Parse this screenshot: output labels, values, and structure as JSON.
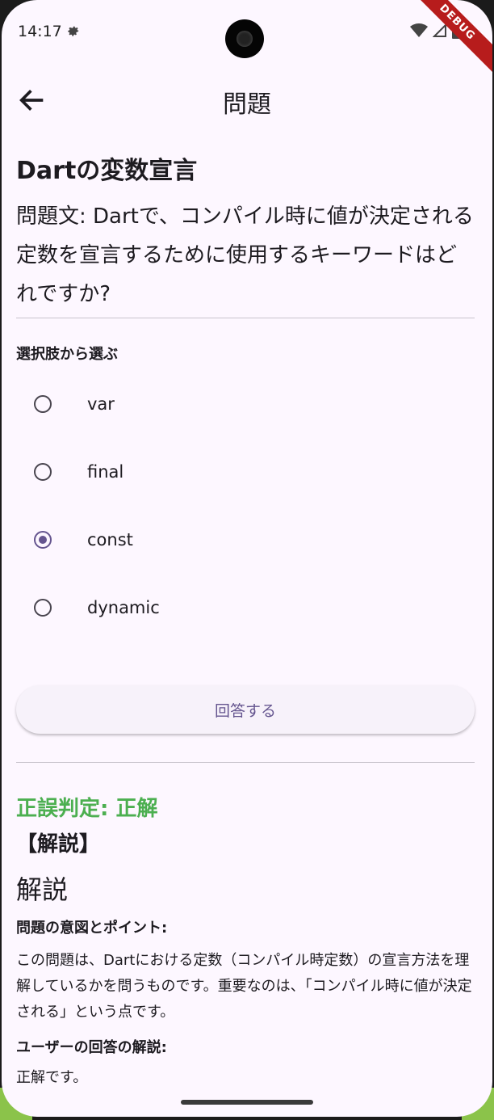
{
  "status_bar": {
    "time": "14:17",
    "debug_label": "DEBUG"
  },
  "app_bar": {
    "title": "問題"
  },
  "question": {
    "title": "Dartの変数宣言",
    "text": "問題文: Dartで、コンパイル時に値が決定される定数を宣言するために使用するキーワードはどれですか?"
  },
  "choices": {
    "label": "選択肢から選ぶ",
    "options": [
      {
        "label": "var",
        "selected": false
      },
      {
        "label": "final",
        "selected": false
      },
      {
        "label": "const",
        "selected": true
      },
      {
        "label": "dynamic",
        "selected": false
      }
    ]
  },
  "answer_button": {
    "label": "回答する"
  },
  "result": {
    "judgement": "正誤判定: 正解",
    "explanation_heading": "【解説】",
    "explanation_title": "解説",
    "intent_heading": "問題の意図とポイント:",
    "intent_text": "この問題は、Dartにおける定数（コンパイル時定数）の宣言方法を理解しているかを問うものです。重要なのは、「コンパイル時に値が決定される」という点です。",
    "user_answer_heading": "ユーザーの回答の解説:",
    "user_answer_text": "正解です。"
  },
  "colors": {
    "background": "#fdf7ff",
    "accent": "#65558f",
    "correct": "#4caf50"
  }
}
